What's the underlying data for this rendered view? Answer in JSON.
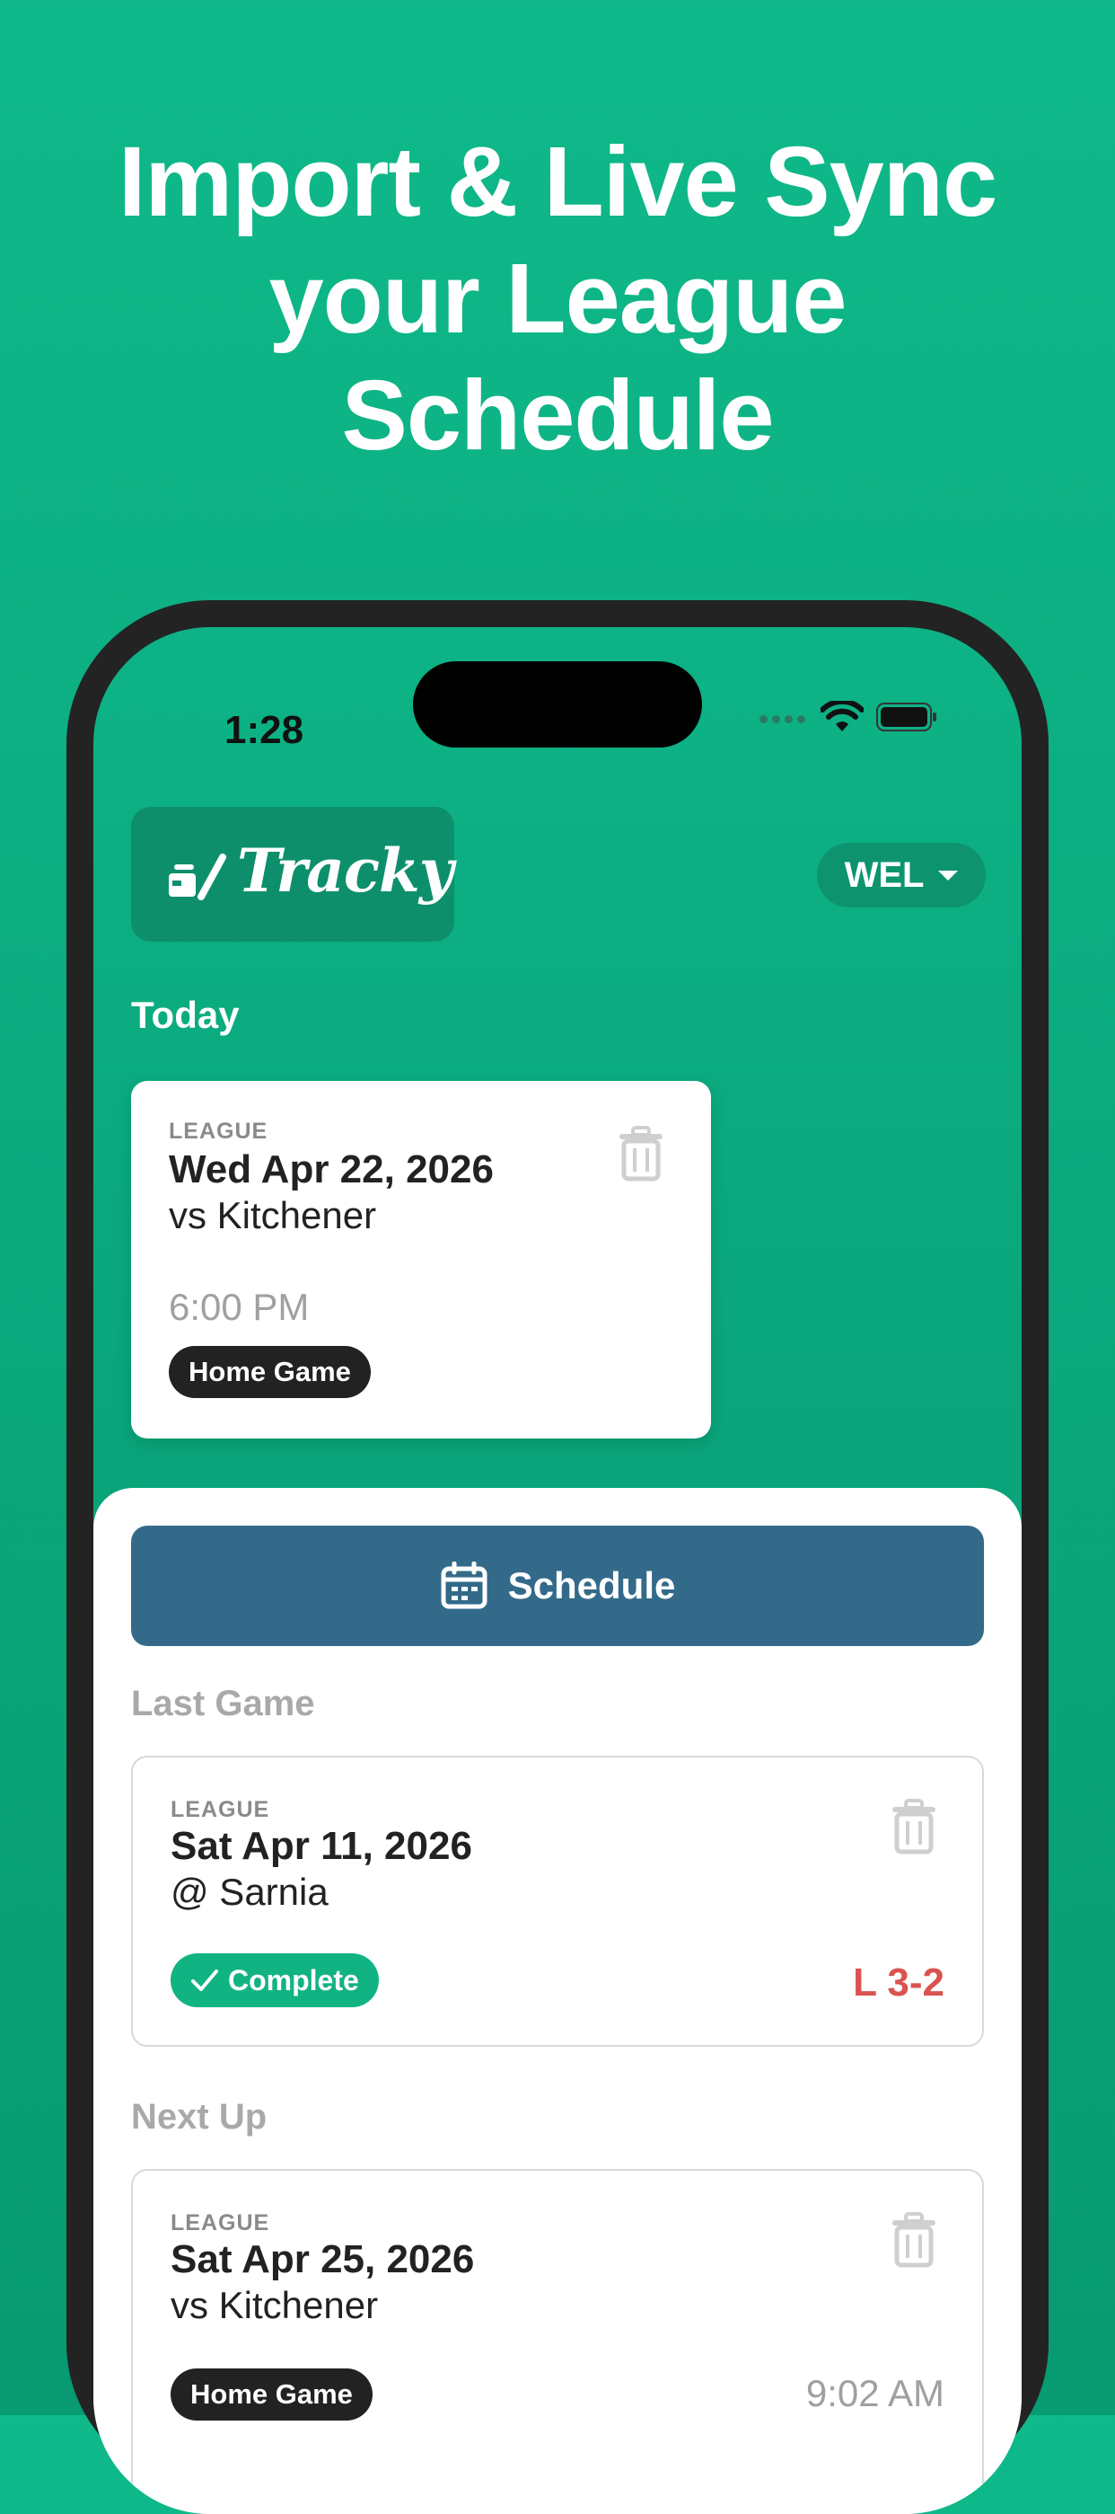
{
  "headline": {
    "line1": "Import & Live Sync",
    "line2": "your League",
    "line3": "Schedule"
  },
  "status_bar": {
    "time": "1:28"
  },
  "app": {
    "logo_text": "Tracky",
    "team_selector": "WEL"
  },
  "today": {
    "section_title": "Today",
    "card": {
      "type_label": "LEAGUE",
      "date": "Wed Apr 22, 2026",
      "opponent": "vs Kitchener",
      "time": "6:00 PM",
      "badge": "Home Game"
    }
  },
  "schedule_button": {
    "label": "Schedule",
    "icon": "calendar-icon"
  },
  "last_game": {
    "section_title": "Last Game",
    "card": {
      "type_label": "LEAGUE",
      "date": "Sat Apr 11, 2026",
      "opponent": "@ Sarnia",
      "status": "Complete",
      "score": "L 3-2"
    }
  },
  "next_up": {
    "section_title": "Next Up",
    "card": {
      "type_label": "LEAGUE",
      "date": "Sat Apr 25, 2026",
      "opponent": "vs Kitchener",
      "time": "9:02 AM",
      "badge": "Home Game"
    }
  },
  "colors": {
    "background": "#0fb98a",
    "schedule_button": "#336a8a",
    "complete_badge": "#12b382",
    "loss_score": "#d9534f",
    "dark_badge": "#222222"
  }
}
